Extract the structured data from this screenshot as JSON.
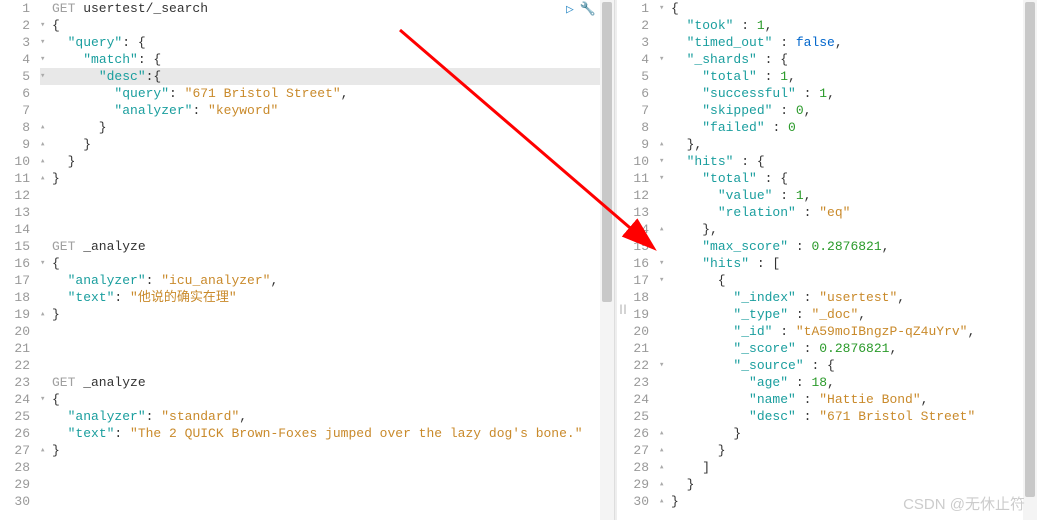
{
  "actions": {
    "run": "▷",
    "wrench": "🔧"
  },
  "left": {
    "lines": [
      {
        "n": 1,
        "fold": "",
        "seg": [
          [
            "method",
            "GET"
          ],
          [
            "path",
            " usertest/_search"
          ]
        ]
      },
      {
        "n": 2,
        "fold": "▾",
        "seg": [
          [
            "punct",
            "{"
          ]
        ]
      },
      {
        "n": 3,
        "fold": "▾",
        "seg": [
          [
            "punct",
            "  "
          ],
          [
            "key",
            "\"query\""
          ],
          [
            "punct",
            ": {"
          ]
        ]
      },
      {
        "n": 4,
        "fold": "▾",
        "seg": [
          [
            "punct",
            "    "
          ],
          [
            "key",
            "\"match\""
          ],
          [
            "punct",
            ": {"
          ]
        ]
      },
      {
        "n": 5,
        "fold": "▾",
        "hl": true,
        "seg": [
          [
            "punct",
            "      "
          ],
          [
            "key",
            "\"desc\""
          ],
          [
            "punct",
            ":{"
          ]
        ]
      },
      {
        "n": 6,
        "fold": "",
        "seg": [
          [
            "punct",
            "        "
          ],
          [
            "key",
            "\"query\""
          ],
          [
            "punct",
            ": "
          ],
          [
            "str",
            "\"671 Bristol Street\""
          ],
          [
            "punct",
            ","
          ]
        ]
      },
      {
        "n": 7,
        "fold": "",
        "seg": [
          [
            "punct",
            "        "
          ],
          [
            "key",
            "\"analyzer\""
          ],
          [
            "punct",
            ": "
          ],
          [
            "str",
            "\"keyword\""
          ]
        ]
      },
      {
        "n": 8,
        "fold": "▴",
        "seg": [
          [
            "punct",
            "      }"
          ]
        ]
      },
      {
        "n": 9,
        "fold": "▴",
        "seg": [
          [
            "punct",
            "    }"
          ]
        ]
      },
      {
        "n": 10,
        "fold": "▴",
        "seg": [
          [
            "punct",
            "  }"
          ]
        ]
      },
      {
        "n": 11,
        "fold": "▴",
        "seg": [
          [
            "punct",
            "}"
          ]
        ]
      },
      {
        "n": 12,
        "fold": "",
        "seg": []
      },
      {
        "n": 13,
        "fold": "",
        "seg": []
      },
      {
        "n": 14,
        "fold": "",
        "seg": []
      },
      {
        "n": 15,
        "fold": "",
        "seg": [
          [
            "method",
            "GET"
          ],
          [
            "path",
            " _analyze"
          ]
        ]
      },
      {
        "n": 16,
        "fold": "▾",
        "seg": [
          [
            "punct",
            "{"
          ]
        ]
      },
      {
        "n": 17,
        "fold": "",
        "seg": [
          [
            "punct",
            "  "
          ],
          [
            "key",
            "\"analyzer\""
          ],
          [
            "punct",
            ": "
          ],
          [
            "str",
            "\"icu_analyzer\""
          ],
          [
            "punct",
            ","
          ]
        ]
      },
      {
        "n": 18,
        "fold": "",
        "seg": [
          [
            "punct",
            "  "
          ],
          [
            "key",
            "\"text\""
          ],
          [
            "punct",
            ": "
          ],
          [
            "str",
            "\"他说的确实在理\""
          ]
        ]
      },
      {
        "n": 19,
        "fold": "▴",
        "seg": [
          [
            "punct",
            "}"
          ]
        ]
      },
      {
        "n": 20,
        "fold": "",
        "seg": []
      },
      {
        "n": 21,
        "fold": "",
        "seg": []
      },
      {
        "n": 22,
        "fold": "",
        "seg": []
      },
      {
        "n": 23,
        "fold": "",
        "seg": [
          [
            "method",
            "GET"
          ],
          [
            "path",
            " _analyze"
          ]
        ]
      },
      {
        "n": 24,
        "fold": "▾",
        "seg": [
          [
            "punct",
            "{"
          ]
        ]
      },
      {
        "n": 25,
        "fold": "",
        "seg": [
          [
            "punct",
            "  "
          ],
          [
            "key",
            "\"analyzer\""
          ],
          [
            "punct",
            ": "
          ],
          [
            "str",
            "\"standard\""
          ],
          [
            "punct",
            ","
          ]
        ]
      },
      {
        "n": 26,
        "fold": "",
        "seg": [
          [
            "punct",
            "  "
          ],
          [
            "key",
            "\"text\""
          ],
          [
            "punct",
            ": "
          ],
          [
            "str",
            "\"The 2 QUICK Brown-Foxes jumped over the lazy dog's bone.\""
          ]
        ]
      },
      {
        "n": 27,
        "fold": "▴",
        "seg": [
          [
            "punct",
            "}"
          ]
        ]
      },
      {
        "n": 28,
        "fold": "",
        "seg": []
      },
      {
        "n": 29,
        "fold": "",
        "seg": []
      },
      {
        "n": 30,
        "fold": "",
        "seg": []
      }
    ]
  },
  "right": {
    "lines": [
      {
        "n": 1,
        "fold": "▾",
        "seg": [
          [
            "punct",
            "{"
          ]
        ]
      },
      {
        "n": 2,
        "fold": "",
        "seg": [
          [
            "punct",
            "  "
          ],
          [
            "key",
            "\"took\""
          ],
          [
            "punct",
            " : "
          ],
          [
            "num",
            "1"
          ],
          [
            "punct",
            ","
          ]
        ]
      },
      {
        "n": 3,
        "fold": "",
        "seg": [
          [
            "punct",
            "  "
          ],
          [
            "key",
            "\"timed_out\""
          ],
          [
            "punct",
            " : "
          ],
          [
            "bool",
            "false"
          ],
          [
            "punct",
            ","
          ]
        ]
      },
      {
        "n": 4,
        "fold": "▾",
        "seg": [
          [
            "punct",
            "  "
          ],
          [
            "key",
            "\"_shards\""
          ],
          [
            "punct",
            " : {"
          ]
        ]
      },
      {
        "n": 5,
        "fold": "",
        "seg": [
          [
            "punct",
            "    "
          ],
          [
            "key",
            "\"total\""
          ],
          [
            "punct",
            " : "
          ],
          [
            "num",
            "1"
          ],
          [
            "punct",
            ","
          ]
        ]
      },
      {
        "n": 6,
        "fold": "",
        "seg": [
          [
            "punct",
            "    "
          ],
          [
            "key",
            "\"successful\""
          ],
          [
            "punct",
            " : "
          ],
          [
            "num",
            "1"
          ],
          [
            "punct",
            ","
          ]
        ]
      },
      {
        "n": 7,
        "fold": "",
        "seg": [
          [
            "punct",
            "    "
          ],
          [
            "key",
            "\"skipped\""
          ],
          [
            "punct",
            " : "
          ],
          [
            "num",
            "0"
          ],
          [
            "punct",
            ","
          ]
        ]
      },
      {
        "n": 8,
        "fold": "",
        "seg": [
          [
            "punct",
            "    "
          ],
          [
            "key",
            "\"failed\""
          ],
          [
            "punct",
            " : "
          ],
          [
            "num",
            "0"
          ]
        ]
      },
      {
        "n": 9,
        "fold": "▴",
        "seg": [
          [
            "punct",
            "  },"
          ]
        ]
      },
      {
        "n": 10,
        "fold": "▾",
        "seg": [
          [
            "punct",
            "  "
          ],
          [
            "key",
            "\"hits\""
          ],
          [
            "punct",
            " : {"
          ]
        ]
      },
      {
        "n": 11,
        "fold": "▾",
        "seg": [
          [
            "punct",
            "    "
          ],
          [
            "key",
            "\"total\""
          ],
          [
            "punct",
            " : {"
          ]
        ]
      },
      {
        "n": 12,
        "fold": "",
        "seg": [
          [
            "punct",
            "      "
          ],
          [
            "key",
            "\"value\""
          ],
          [
            "punct",
            " : "
          ],
          [
            "num",
            "1"
          ],
          [
            "punct",
            ","
          ]
        ]
      },
      {
        "n": 13,
        "fold": "",
        "seg": [
          [
            "punct",
            "      "
          ],
          [
            "key",
            "\"relation\""
          ],
          [
            "punct",
            " : "
          ],
          [
            "str",
            "\"eq\""
          ]
        ]
      },
      {
        "n": 14,
        "fold": "▴",
        "seg": [
          [
            "punct",
            "    },"
          ]
        ]
      },
      {
        "n": 15,
        "fold": "",
        "seg": [
          [
            "punct",
            "    "
          ],
          [
            "key",
            "\"max_score\""
          ],
          [
            "punct",
            " : "
          ],
          [
            "num",
            "0.2876821"
          ],
          [
            "punct",
            ","
          ]
        ]
      },
      {
        "n": 16,
        "fold": "▾",
        "seg": [
          [
            "punct",
            "    "
          ],
          [
            "key",
            "\"hits\""
          ],
          [
            "punct",
            " : ["
          ]
        ]
      },
      {
        "n": 17,
        "fold": "▾",
        "seg": [
          [
            "punct",
            "      {"
          ]
        ]
      },
      {
        "n": 18,
        "fold": "",
        "seg": [
          [
            "punct",
            "        "
          ],
          [
            "key",
            "\"_index\""
          ],
          [
            "punct",
            " : "
          ],
          [
            "str",
            "\"usertest\""
          ],
          [
            "punct",
            ","
          ]
        ]
      },
      {
        "n": 19,
        "fold": "",
        "seg": [
          [
            "punct",
            "        "
          ],
          [
            "key",
            "\"_type\""
          ],
          [
            "punct",
            " : "
          ],
          [
            "str",
            "\"_doc\""
          ],
          [
            "punct",
            ","
          ]
        ]
      },
      {
        "n": 20,
        "fold": "",
        "seg": [
          [
            "punct",
            "        "
          ],
          [
            "key",
            "\"_id\""
          ],
          [
            "punct",
            " : "
          ],
          [
            "str",
            "\"tA59moIBngzP-qZ4uYrv\""
          ],
          [
            "punct",
            ","
          ]
        ]
      },
      {
        "n": 21,
        "fold": "",
        "seg": [
          [
            "punct",
            "        "
          ],
          [
            "key",
            "\"_score\""
          ],
          [
            "punct",
            " : "
          ],
          [
            "num",
            "0.2876821"
          ],
          [
            "punct",
            ","
          ]
        ]
      },
      {
        "n": 22,
        "fold": "▾",
        "seg": [
          [
            "punct",
            "        "
          ],
          [
            "key",
            "\"_source\""
          ],
          [
            "punct",
            " : {"
          ]
        ]
      },
      {
        "n": 23,
        "fold": "",
        "seg": [
          [
            "punct",
            "          "
          ],
          [
            "key",
            "\"age\""
          ],
          [
            "punct",
            " : "
          ],
          [
            "num",
            "18"
          ],
          [
            "punct",
            ","
          ]
        ]
      },
      {
        "n": 24,
        "fold": "",
        "seg": [
          [
            "punct",
            "          "
          ],
          [
            "key",
            "\"name\""
          ],
          [
            "punct",
            " : "
          ],
          [
            "str",
            "\"Hattie Bond\""
          ],
          [
            "punct",
            ","
          ]
        ]
      },
      {
        "n": 25,
        "fold": "",
        "seg": [
          [
            "punct",
            "          "
          ],
          [
            "key",
            "\"desc\""
          ],
          [
            "punct",
            " : "
          ],
          [
            "str",
            "\"671 Bristol Street\""
          ]
        ]
      },
      {
        "n": 26,
        "fold": "▴",
        "seg": [
          [
            "punct",
            "        }"
          ]
        ]
      },
      {
        "n": 27,
        "fold": "▴",
        "seg": [
          [
            "punct",
            "      }"
          ]
        ]
      },
      {
        "n": 28,
        "fold": "▴",
        "seg": [
          [
            "punct",
            "    ]"
          ]
        ]
      },
      {
        "n": 29,
        "fold": "▴",
        "seg": [
          [
            "punct",
            "  }"
          ]
        ]
      },
      {
        "n": 30,
        "fold": "▴",
        "seg": [
          [
            "punct",
            "}"
          ]
        ]
      }
    ]
  },
  "watermark": "CSDN @无休止符"
}
